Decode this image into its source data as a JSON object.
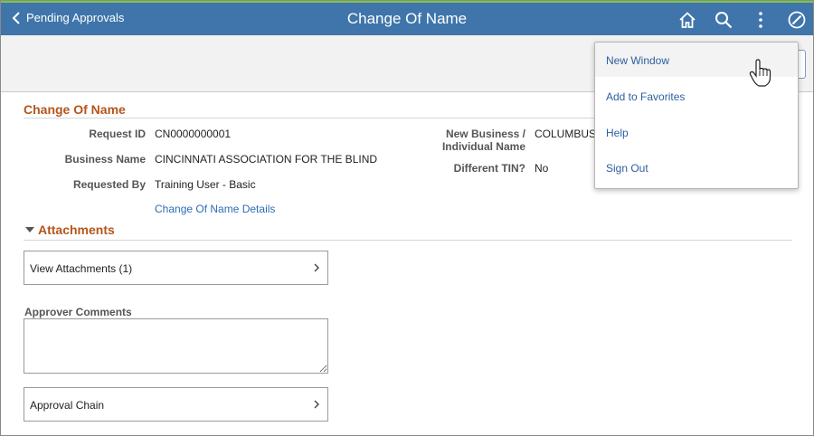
{
  "header": {
    "back_label": "Pending Approvals",
    "title": "Change Of Name",
    "icons": [
      "home-icon",
      "search-icon",
      "more-vertical-icon",
      "navbar-compass-icon"
    ]
  },
  "section": {
    "title": "Change Of Name",
    "request_id_label": "Request ID",
    "request_id_value": "CN0000000001",
    "business_name_label": "Business Name",
    "business_name_value": "CINCINNATI ASSOCIATION FOR THE BLIND",
    "requested_by_label": "Requested By",
    "requested_by_value": "Training User - Basic",
    "details_link": "Change Of Name Details",
    "new_business_label_line1": "New Business /",
    "new_business_label_line2": "Individual Name",
    "new_business_value": "COLUMBUS",
    "different_tin_label": "Different TIN?",
    "different_tin_value": "No"
  },
  "attachments": {
    "title": "Attachments",
    "view_label": "View Attachments (1)"
  },
  "comments": {
    "label": "Approver Comments",
    "value": ""
  },
  "approval_chain": {
    "label": "Approval Chain"
  },
  "menu": {
    "items": [
      {
        "label": "New Window"
      },
      {
        "label": "Add to Favorites"
      },
      {
        "label": "Help"
      },
      {
        "label": "Sign Out"
      }
    ]
  }
}
